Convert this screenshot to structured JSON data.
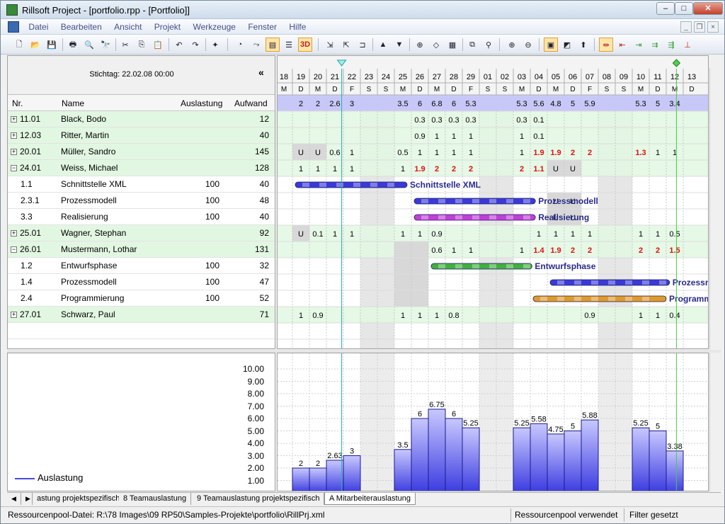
{
  "window": {
    "title": "Rillsoft Project - [portfolio.rpp - [Portfolio]]",
    "min": "–",
    "max": "□",
    "close": "✕"
  },
  "menu": [
    "Datei",
    "Bearbeiten",
    "Ansicht",
    "Projekt",
    "Werkzeuge",
    "Fenster",
    "Hilfe"
  ],
  "toolbar": {
    "label_3d": "3D"
  },
  "header": {
    "stichtag": "Stichtag: 22.02.08 00:00",
    "collapse": "«"
  },
  "columns": {
    "nr": "Nr.",
    "name": "Name",
    "auslastung": "Auslastung",
    "aufwand": "Aufwand"
  },
  "rows": [
    {
      "type": "grp",
      "nr": "11.01",
      "name": "Black, Bodo",
      "aus": "",
      "auf": "12"
    },
    {
      "type": "grp",
      "nr": "12.03",
      "name": "Ritter, Martin",
      "aus": "",
      "auf": "40"
    },
    {
      "type": "grp",
      "nr": "20.01",
      "name": "Müller, Sandro",
      "aus": "",
      "auf": "145"
    },
    {
      "type": "grpopen",
      "nr": "24.01",
      "name": "Weiss, Michael",
      "aus": "",
      "auf": "128"
    },
    {
      "type": "task",
      "nr": "1.1",
      "name": "Schnittstelle XML",
      "aus": "100",
      "auf": "40"
    },
    {
      "type": "task",
      "nr": "2.3.1",
      "name": "Prozessmodell",
      "aus": "100",
      "auf": "48"
    },
    {
      "type": "task",
      "nr": "3.3",
      "name": "Realisierung",
      "aus": "100",
      "auf": "40"
    },
    {
      "type": "grp",
      "nr": "25.01",
      "name": "Wagner, Stephan",
      "aus": "",
      "auf": "92"
    },
    {
      "type": "grpopen",
      "nr": "26.01",
      "name": "Mustermann, Lothar",
      "aus": "",
      "auf": "131"
    },
    {
      "type": "task",
      "nr": "1.2",
      "name": "Entwurfsphase",
      "aus": "100",
      "auf": "32"
    },
    {
      "type": "task",
      "nr": "1.4",
      "name": "Prozessmodell",
      "aus": "100",
      "auf": "47"
    },
    {
      "type": "task",
      "nr": "2.4",
      "name": "Programmierung",
      "aus": "100",
      "auf": "52"
    },
    {
      "type": "grp",
      "nr": "27.01",
      "name": "Schwarz, Paul",
      "aus": "",
      "auf": "71"
    }
  ],
  "days": [
    "18",
    "19",
    "20",
    "21",
    "22",
    "23",
    "24",
    "25",
    "26",
    "27",
    "28",
    "29",
    "01",
    "02",
    "03",
    "04",
    "05",
    "06",
    "07",
    "08",
    "09",
    "10",
    "11",
    "12",
    "13"
  ],
  "weekdays": [
    "M",
    "D",
    "M",
    "D",
    "F",
    "S",
    "S",
    "M",
    "D",
    "M",
    "D",
    "F",
    "S",
    "S",
    "M",
    "D",
    "M",
    "D",
    "F",
    "S",
    "S",
    "M",
    "D",
    "M",
    "D"
  ],
  "weekend_idx": [
    5,
    6,
    12,
    13,
    19,
    20
  ],
  "sum_row": [
    "",
    "2",
    "2",
    "2.6",
    "3",
    "",
    "",
    "3.5",
    "6",
    "6.8",
    "6",
    "5.3",
    "",
    "",
    "5.3",
    "5.6",
    "4.8",
    "5",
    "5.9",
    "",
    "",
    "5.3",
    "5",
    "3.4",
    ""
  ],
  "cells": [
    {
      "row": 0,
      "vals": {
        "8": "0.3",
        "9": "0.3",
        "10": "0.3",
        "11": "0.3",
        "14": "0.3",
        "15": "0.1"
      }
    },
    {
      "row": 1,
      "vals": {
        "8": "0.9",
        "9": "1",
        "10": "1",
        "11": "1",
        "14": "1",
        "15": "0.1"
      }
    },
    {
      "row": 2,
      "vals": {
        "1": "U",
        "2": "U",
        "3": "0.6",
        "4": "1",
        "7": "0.5",
        "8": "1",
        "9": "1",
        "10": "1",
        "11": "1",
        "14": "1",
        "15": "1.9",
        "16": "1.9",
        "17": "2",
        "18": "2",
        "21": "1.3",
        "22": "1",
        "23": "1"
      }
    },
    {
      "row": 3,
      "vals": {
        "1": "1",
        "2": "1",
        "3": "1",
        "4": "1",
        "7": "1",
        "8": "1.9",
        "9": "2",
        "10": "2",
        "11": "2",
        "14": "2",
        "15": "1.1",
        "16": "U",
        "17": "U"
      }
    },
    {
      "row": 5,
      "vals": {
        "16": "U",
        "17": "U"
      }
    },
    {
      "row": 6,
      "vals": {
        "16": "U",
        "17": "U"
      }
    },
    {
      "row": 7,
      "vals": {
        "1": "U",
        "2": "0.1",
        "3": "1",
        "4": "1",
        "7": "1",
        "8": "1",
        "9": "0.9",
        "15": "1",
        "16": "1",
        "17": "1",
        "18": "1",
        "21": "1",
        "22": "1",
        "23": "0.5"
      }
    },
    {
      "row": 8,
      "vals": {
        "9": "0.6",
        "10": "1",
        "11": "1",
        "14": "1",
        "15": "1.4",
        "16": "1.9",
        "17": "2",
        "18": "2",
        "21": "2",
        "22": "2",
        "23": "1.5"
      }
    },
    {
      "row": 12,
      "vals": {
        "1": "1",
        "2": "0.9",
        "7": "1",
        "8": "1",
        "9": "1",
        "10": "0.8",
        "18": "0.9",
        "21": "1",
        "22": "1",
        "23": "0.4"
      }
    }
  ],
  "overload_values": [
    "1.9",
    "2",
    "1.4",
    "1.5",
    "1.3",
    "1.1"
  ],
  "gray_cells": [
    {
      "row": 2,
      "cols": [
        1,
        2
      ]
    },
    {
      "row": 3,
      "cols": [
        16,
        17
      ]
    },
    {
      "row": 5,
      "cols": [
        16,
        17
      ]
    },
    {
      "row": 6,
      "cols": [
        16,
        17
      ]
    },
    {
      "row": 7,
      "cols": [
        1
      ]
    },
    {
      "row": 8,
      "cols": [
        7,
        8
      ]
    },
    {
      "row": 9,
      "cols": [
        7,
        8
      ]
    },
    {
      "row": 10,
      "cols": [
        7,
        8
      ]
    },
    {
      "row": 11,
      "cols": [
        7,
        8
      ]
    }
  ],
  "bars": [
    {
      "row": 4,
      "label": "Schnittstelle XML",
      "start": 1,
      "end": 7.75,
      "color": "#3a3ad8"
    },
    {
      "row": 5,
      "label": "Prozessmodell",
      "start": 8,
      "end": 15.3,
      "color": "#3a3ad8"
    },
    {
      "row": 6,
      "label": "Realisierung",
      "start": 8,
      "end": 15.3,
      "color": "#c040d8"
    },
    {
      "row": 9,
      "label": "Entwurfsphase",
      "start": 9,
      "end": 15.1,
      "color": "#40b040"
    },
    {
      "row": 10,
      "label": "Prozessmodell",
      "start": 16,
      "end": 23.2,
      "color": "#3a3ad8"
    },
    {
      "row": 11,
      "label": "Programmierung",
      "start": 15,
      "end": 23,
      "color": "#e09a2a"
    }
  ],
  "chart_data": {
    "type": "bar",
    "categories": [
      "18",
      "19",
      "20",
      "21",
      "22",
      "23",
      "24",
      "25",
      "26",
      "27",
      "28",
      "29",
      "01",
      "02",
      "03",
      "04",
      "05",
      "06",
      "07",
      "08",
      "09",
      "10",
      "11",
      "12",
      "13"
    ],
    "series": [
      {
        "name": "Auslastung",
        "values": [
          null,
          2,
          2,
          2.63,
          3,
          null,
          null,
          3.5,
          6,
          6.75,
          6,
          5.25,
          null,
          null,
          5.25,
          5.58,
          4.75,
          5,
          5.88,
          null,
          null,
          5.25,
          5,
          3.38,
          null
        ]
      }
    ],
    "value_labels": [
      "",
      "2",
      "2",
      "2.63",
      "3",
      "",
      "",
      "3.5",
      "6",
      "6.75",
      "6",
      "5.25",
      "",
      "",
      "5.25",
      "5.58",
      "4.75",
      "5",
      "5.88",
      "",
      "",
      "5.25",
      "5",
      "3.38",
      ""
    ],
    "yticks": [
      "10.00",
      "9.00",
      "8.00",
      "7.00",
      "6.00",
      "5.00",
      "4.00",
      "3.00",
      "2.00",
      "1.00"
    ],
    "ylim": [
      0,
      10
    ],
    "grid": true,
    "legend": "bottom-left"
  },
  "tabs": [
    "astung projektspezifisch",
    "8 Teamauslastung",
    "9 Teamauslastung projektspezifisch",
    "A Mitarbeiterauslastung"
  ],
  "status": {
    "file": "Ressourcenpool-Datei: R:\\78 Images\\09 RP50\\Samples-Projekte\\portfolio\\RillPrj.xml",
    "pool": "Ressourcenpool verwendet",
    "filter": "Filter gesetzt"
  }
}
